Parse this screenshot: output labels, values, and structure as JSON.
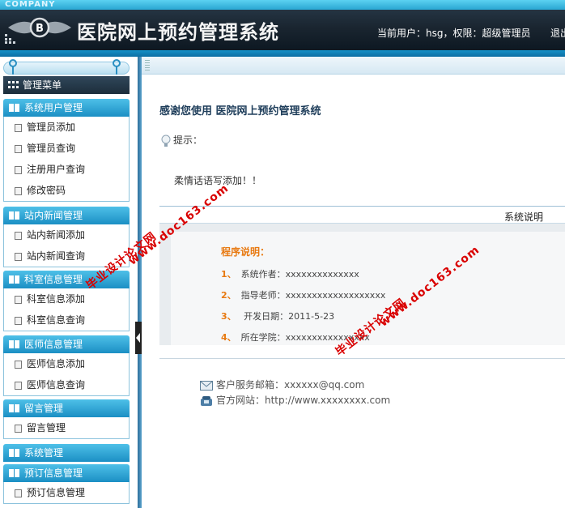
{
  "header": {
    "company": "COMPANY",
    "title": "医院网上预约管理系统",
    "user_info": "当前用户：hsg，权限：超级管理员",
    "logout": "退出"
  },
  "sidebar": {
    "menu_title": "管理菜单",
    "groups": [
      {
        "title": "系统用户管理",
        "items": [
          "管理员添加",
          "管理员查询",
          "注册用户查询",
          "修改密码"
        ]
      },
      {
        "title": "站内新闻管理",
        "items": [
          "站内新闻添加",
          "站内新闻查询"
        ]
      },
      {
        "title": "科室信息管理",
        "items": [
          "科室信息添加",
          "科室信息查询"
        ]
      },
      {
        "title": "医师信息管理",
        "items": [
          "医师信息添加",
          "医师信息查询"
        ]
      },
      {
        "title": "留言管理",
        "items": [
          "留言管理"
        ]
      },
      {
        "title": "系统管理",
        "items": []
      },
      {
        "title": "预订信息管理",
        "items": [
          "预订信息管理"
        ]
      }
    ]
  },
  "main": {
    "thanks": "感谢您使用 医院网上预约管理系统",
    "tip_label": "提示：",
    "greeting": "柔情话语写添加！！",
    "info_header": "系统说明",
    "program_title": "程序说明：",
    "info_rows": [
      {
        "num": "1、",
        "text": "系统作者：xxxxxxxxxxxxxx"
      },
      {
        "num": "2、",
        "text": "指导老师：xxxxxxxxxxxxxxxxxxx"
      },
      {
        "num": "3、",
        "text": " 开发日期：2011-5-23"
      },
      {
        "num": "4、",
        "text": "所在学院：xxxxxxxxxxxxxxxx"
      }
    ],
    "email": "客户服务邮箱：xxxxxx@qq.com",
    "website": "官方网站：http://www.xxxxxxxx.com"
  },
  "watermarks": [
    "毕业设计论文网",
    "www.doc163.com"
  ],
  "colors": {
    "accent": "#1b8fc4",
    "orange": "#e87a12",
    "header_dark": "#1a2530",
    "watermark": "#d90000"
  },
  "icons": [
    "logo-emblem",
    "grid-icon",
    "book-icon",
    "doc-icon",
    "bulb-icon",
    "mail-icon",
    "phone-icon"
  ]
}
